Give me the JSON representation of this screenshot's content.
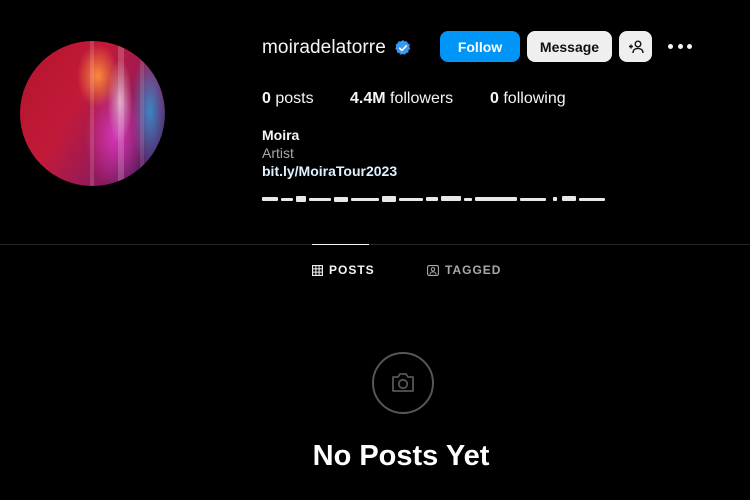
{
  "profile": {
    "username": "moiradelatorre",
    "verified": true,
    "name": "Moira",
    "category": "Artist",
    "link": "bit.ly/MoiraTour2023"
  },
  "actions": {
    "follow_label": "Follow",
    "message_label": "Message"
  },
  "stats": {
    "posts_count": "0",
    "posts_label": "posts",
    "followers_count": "4.4M",
    "followers_label": "followers",
    "following_count": "0",
    "following_label": "following"
  },
  "tabs": {
    "posts_label": "POSTS",
    "tagged_label": "TAGGED"
  },
  "empty_state": {
    "title": "No Posts Yet"
  },
  "colors": {
    "accent": "#0095f6",
    "background": "#000000",
    "secondary_text": "#a8a8a8"
  }
}
